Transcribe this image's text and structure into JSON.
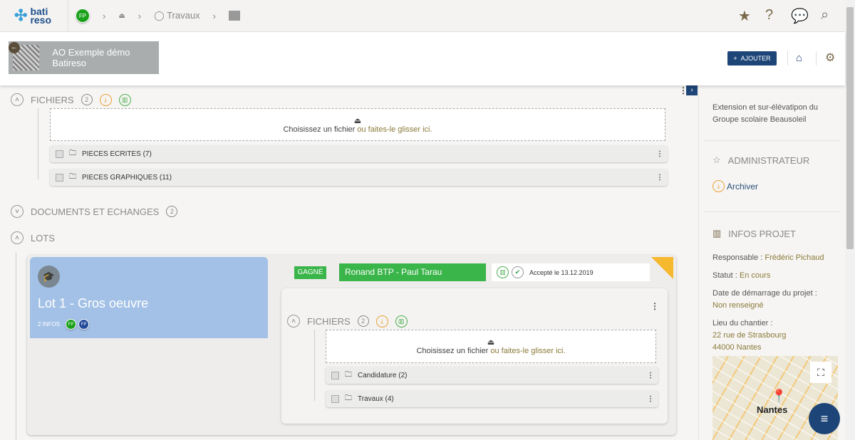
{
  "topbar": {
    "logo": "bati reso",
    "avatar": "FP",
    "breadcrumb": [
      "Travaux"
    ]
  },
  "header": {
    "project_title": "AO Exemple démo Batireso",
    "add_label": "AJOUTER"
  },
  "fichiers": {
    "title": "FICHIERS",
    "count": "2",
    "drop_text": "Choisissez un fichier",
    "drop_link": "ou faites-le glisser ici.",
    "folders": [
      "PIECES ECRITES (7)",
      "PIECES GRAPHIQUES (11)"
    ]
  },
  "documents": {
    "title": "DOCUMENTS ET ECHANGES",
    "count": "2"
  },
  "lots": {
    "title": "LOTS",
    "lot": {
      "name": "Lot 1 - Gros oeuvre",
      "infos": "2 INFOS",
      "avatars": [
        "FP",
        "FP"
      ],
      "status": "GAGNÉ",
      "company": "Ronand BTP - Paul Tarau",
      "accepted": "Accepté le 13.12.2019",
      "fichiers": {
        "title": "FICHIERS",
        "count": "2",
        "drop_text": "Choisissez un fichier",
        "drop_link": "ou faites-le glisser ici.",
        "folders": [
          "Candidature (2)",
          "Travaux (4)"
        ]
      }
    }
  },
  "sidebar": {
    "description": "Extension et sur-élévatipon du Groupe scolaire Beausoleil",
    "admin_title": "ADMINISTRATEUR",
    "archive": "Archiver",
    "infos_title": "INFOS PROJET",
    "responsable_label": "Responsable :",
    "responsable": "Frédéric Pichaud",
    "statut_label": "Statut :",
    "statut": "En cours",
    "date_label": "Date de démarrage du projet :",
    "date": "Non renseigné",
    "lieu_label": "Lieu du chantier :",
    "address1": "22 rue de Strasbourg",
    "address2": "44000 Nantes",
    "map_city": "Nantes"
  },
  "colors": {
    "brand": "#1d4577",
    "green": "#3ab54a",
    "accent": "#8b7a3a",
    "lot_bg": "#a3c1e6"
  }
}
